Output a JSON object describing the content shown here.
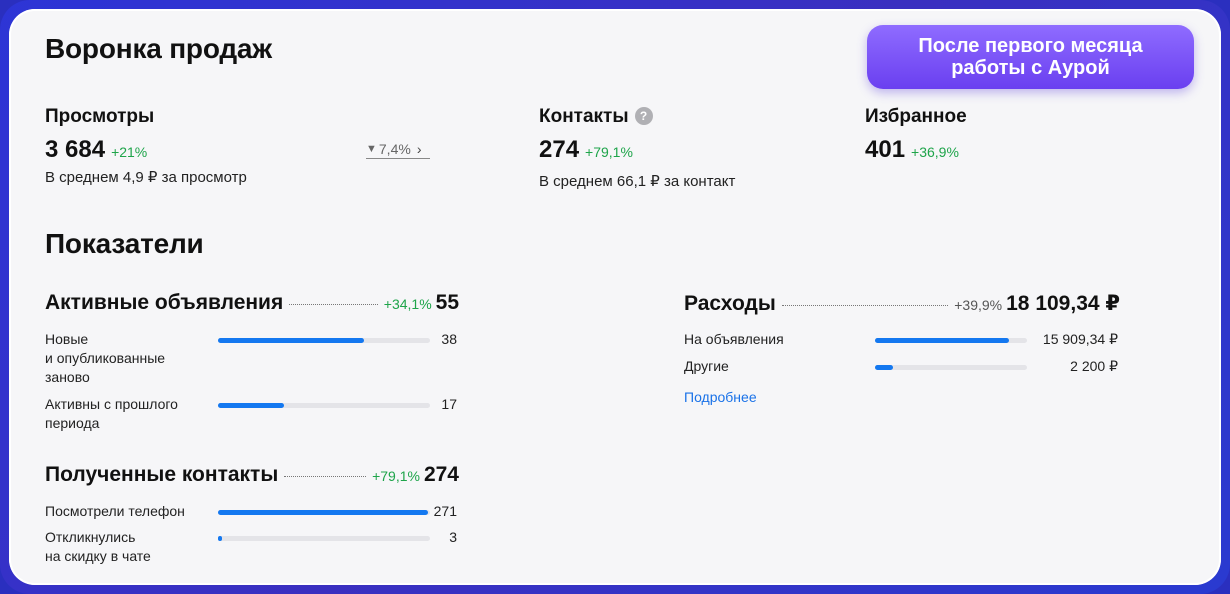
{
  "header": {
    "title": "Воронка продаж",
    "promo_label": "После первого месяца работы с Аурой"
  },
  "funnel": {
    "views": {
      "label": "Просмотры",
      "value": "3 684",
      "delta": "+21%",
      "compare": "7,4%",
      "sub": "В среднем 4,9 ₽ за просмотр"
    },
    "contacts": {
      "label": "Контакты",
      "help_icon": "question-icon",
      "value": "274",
      "delta": "+79,1%",
      "sub": "В среднем 66,1 ₽ за контакт"
    },
    "favorites": {
      "label": "Избранное",
      "value": "401",
      "delta": "+36,9%"
    }
  },
  "indicators": {
    "title": "Показатели",
    "active_ads": {
      "title": "Активные объявления",
      "delta": "+34,1%",
      "total": "55",
      "items": [
        {
          "label_line1": "Новые",
          "label_line2": "и опубликованные",
          "label_line3": "заново",
          "value": "38",
          "fraction": 0.69
        },
        {
          "label_line1": "Активны с прошлого",
          "label_line2": "периода",
          "value": "17",
          "fraction": 0.31
        }
      ]
    },
    "received_contacts": {
      "title": "Полученные контакты",
      "delta": "+79,1%",
      "total": "274",
      "items": [
        {
          "label_line1": "Посмотрели телефон",
          "value": "271",
          "fraction": 0.99
        },
        {
          "label_line1": "Откликнулись",
          "label_line2": "на скидку в чате",
          "value": "3",
          "fraction": 0.02
        }
      ]
    },
    "expenses": {
      "title": "Расходы",
      "delta": "+39,9%",
      "total": "18 109,34 ₽",
      "items": [
        {
          "label_line1": "На объявления",
          "value": "15 909,34 ₽",
          "fraction": 0.88
        },
        {
          "label_line1": "Другие",
          "value": "2 200 ₽",
          "fraction": 0.12
        }
      ],
      "more_link": "Подробнее"
    }
  },
  "colors": {
    "accent_bar": "#1478f0",
    "positive": "#1ea44a",
    "promo_top": "#8f6cff",
    "promo_bottom": "#6a3ff0",
    "frame": "#2d35d6"
  }
}
